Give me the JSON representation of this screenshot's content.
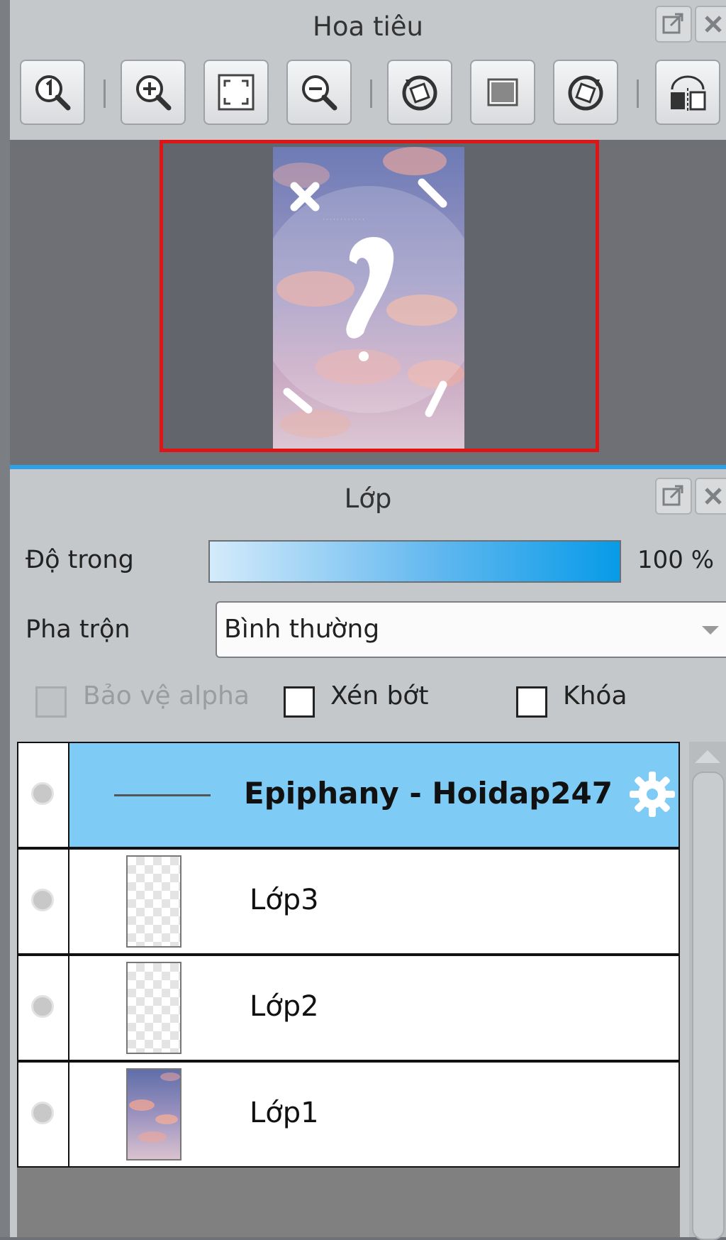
{
  "navigator": {
    "title": "Hoa tiêu",
    "toolbar": [
      {
        "icon": "actual-size-icon"
      },
      {
        "icon": "zoom-in-icon"
      },
      {
        "icon": "fit-to-window-icon"
      },
      {
        "icon": "zoom-out-icon"
      },
      {
        "icon": "rotate-left-icon"
      },
      {
        "icon": "reset-rotation-icon"
      },
      {
        "icon": "rotate-right-icon"
      },
      {
        "icon": "flip-horizontal-icon"
      }
    ]
  },
  "layers": {
    "title": "Lớp",
    "opacity_label": "Độ trong",
    "opacity_value": "100 %",
    "opacity": 100,
    "blend_label": "Pha trộn",
    "blend_value": "Bình thường",
    "protect_alpha": "Bảo vệ alpha",
    "clipping": "Xén bớt",
    "lock": "Khóa",
    "items": [
      {
        "name": "Epiphany - Hoidap247",
        "type": "folder",
        "selected": true
      },
      {
        "name": "Lớp3",
        "type": "layer"
      },
      {
        "name": "Lớp2",
        "type": "layer"
      },
      {
        "name": "Lớp1",
        "type": "layer"
      }
    ]
  },
  "colors": {
    "accent": "#2ea0e6",
    "selected_row": "#7ecbf5",
    "nav_frame": "#e01414"
  }
}
